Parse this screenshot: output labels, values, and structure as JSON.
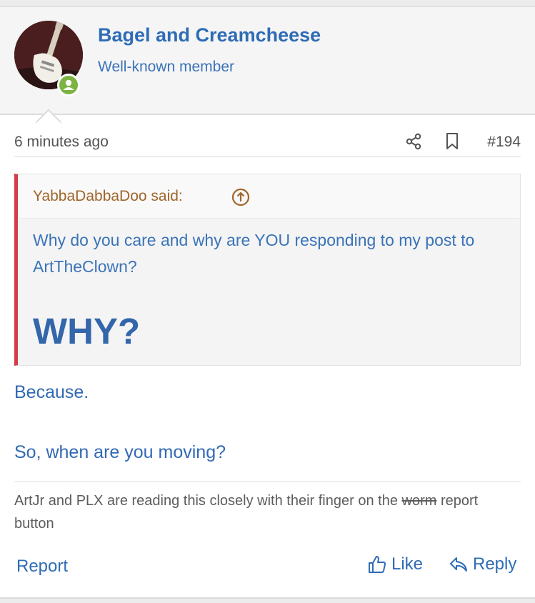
{
  "user": {
    "name": "Bagel and Creamcheese",
    "title": "Well-known member"
  },
  "meta": {
    "time": "6 minutes ago",
    "post_number": "#194"
  },
  "quote": {
    "author_said": "YabbaDabbaDoo said:",
    "text": "Why do you care and why are YOU responding to my post to ArtTheClown?",
    "shout": "WHY?"
  },
  "body": {
    "line1": "Because.",
    "line2": "So, when are you moving?"
  },
  "signature": {
    "part1": "ArtJr and PLX are reading this closely with their finger on the ",
    "struck": "worm",
    "part2": " report button"
  },
  "actions": {
    "report": "Report",
    "like": "Like",
    "reply": "Reply"
  },
  "colors": {
    "link_blue": "#2e6cb5",
    "quote_bar": "#d43c4a",
    "quote_author": "#a0652a",
    "online_green": "#7cb342"
  }
}
